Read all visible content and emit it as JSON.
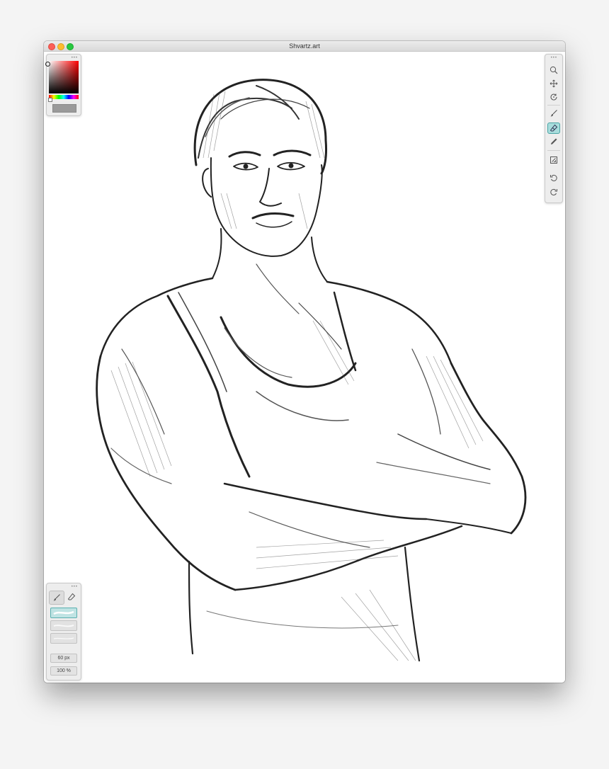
{
  "window": {
    "title": "Shvartz.art"
  },
  "color_panel": {
    "current_color": "#9a9a9a",
    "hue": "#ff0000"
  },
  "tools": [
    {
      "name": "zoom",
      "icon": "magnifier-icon"
    },
    {
      "name": "move",
      "icon": "move-arrows-icon"
    },
    {
      "name": "rotate",
      "icon": "rotate-icon"
    },
    {
      "name": "brush",
      "icon": "brush-icon"
    },
    {
      "name": "eraser",
      "icon": "eraser-icon",
      "active": true
    },
    {
      "name": "pencil",
      "icon": "pencil-icon"
    },
    {
      "name": "canvas",
      "icon": "canvas-size-icon"
    },
    {
      "name": "undo",
      "icon": "undo-icon"
    },
    {
      "name": "redo",
      "icon": "redo-icon"
    }
  ],
  "brush_panel": {
    "size": "60 px",
    "opacity": "100 %",
    "active_mode": "brush"
  },
  "colors": {
    "accent": "#a8dcdc",
    "accent_border": "#4aa5a5"
  }
}
